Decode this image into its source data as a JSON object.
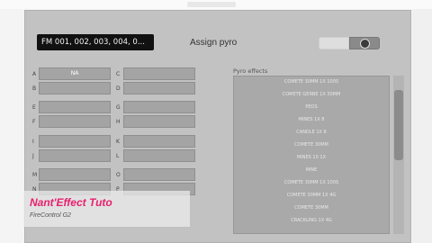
{
  "field": {
    "value": "FM 001, 002, 003, 004, 0..."
  },
  "title": "Assign pyro",
  "pyro_effects_label": "Pyro effects",
  "rows_left": [
    {
      "label": "A",
      "value": "NA"
    },
    {
      "label": "B",
      "value": ""
    },
    {
      "label": "E",
      "value": ""
    },
    {
      "label": "F",
      "value": ""
    },
    {
      "label": "I",
      "value": ""
    },
    {
      "label": "J",
      "value": ""
    },
    {
      "label": "M",
      "value": ""
    },
    {
      "label": "N",
      "value": ""
    }
  ],
  "rows_right": [
    {
      "label": "C",
      "value": ""
    },
    {
      "label": "D",
      "value": ""
    },
    {
      "label": "G",
      "value": ""
    },
    {
      "label": "H",
      "value": ""
    },
    {
      "label": "K",
      "value": ""
    },
    {
      "label": "L",
      "value": ""
    },
    {
      "label": "O",
      "value": ""
    },
    {
      "label": "P",
      "value": ""
    }
  ],
  "pyro_items": [
    "COMETE 30MM 1X 100S",
    "COMETE GERBE 1X 30MM",
    "PEOS",
    "MINES 1X 8",
    "CANDLE 1X 8",
    "COMETE 30MM",
    "MINES 10 1X",
    "MINE",
    "COMETE 30MM 1X 100S",
    "COMETE 30MM 1X 4G",
    "COMETE 30MM",
    "CRACKLING 1X 4G"
  ],
  "overlay": {
    "title": "Nant'Effect Tuto",
    "subtitle": "FireControl G2"
  }
}
